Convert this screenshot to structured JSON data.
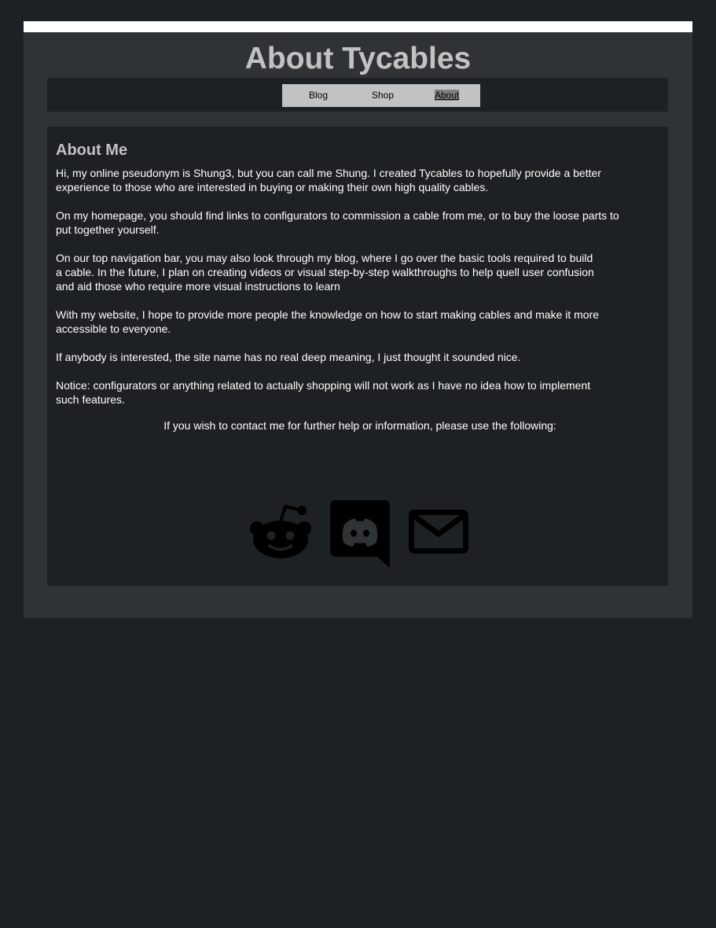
{
  "header": {
    "title": "About Tycables"
  },
  "nav": {
    "items": [
      {
        "label": "Blog"
      },
      {
        "label": "Shop"
      },
      {
        "label": "About"
      }
    ]
  },
  "about": {
    "heading": "About Me",
    "paragraphs": [
      " Hi, my online pseudonym is Shung3, but you can call me Shung. I created Tycables to hopefully provide a better\nexperience to those who are interested in buying or making their own high quality cables.",
      "On my homepage, you should find links to configurators to commission a cable from me, or to buy the loose parts to\nput together yourself.",
      "On our top navigation bar, you may also look through my blog, where I go over the basic tools required to build\n a cable. In the future, I plan on creating videos or visual step-by-step walkthroughs to help quell user confusion\nand aid those who require more visual instructions to learn",
      "With my website, I hope to provide more people the knowledge on how to start making cables and make it more\naccessible to everyone.",
      "If anybody is interested, the site name has no real deep meaning, I just thought it sounded nice.",
      "Notice: configurators or anything related to actually shopping will not work as I have no idea how to implement\nsuch features."
    ],
    "contact_line": "If you wish to contact me for further help or information, please use the following:"
  },
  "contact_icons": [
    {
      "icon": "reddit-icon"
    },
    {
      "icon": "discord-icon"
    },
    {
      "icon": "mail-icon"
    }
  ],
  "colors": {
    "page_background": "#1e2123",
    "container_background": "#2f3336",
    "title_text": "#c2c2c2",
    "nav_menu_background": "#c2c2c2",
    "active_nav_highlight": "#808080",
    "body_text": "#ffffff",
    "icon_color": "#000000"
  }
}
